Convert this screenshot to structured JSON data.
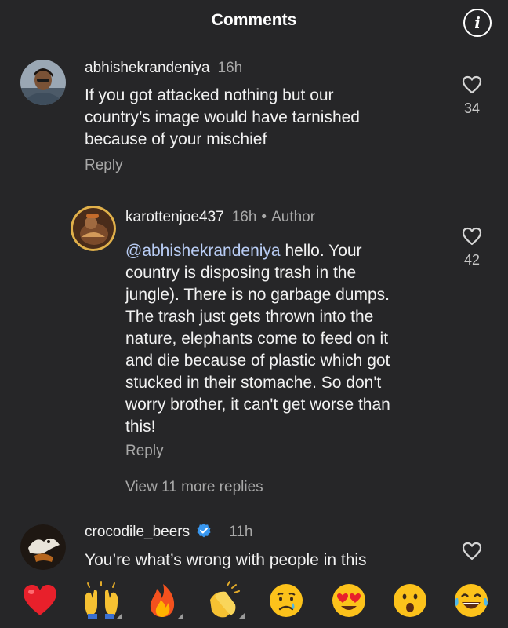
{
  "header": {
    "title": "Comments",
    "info_icon": "info-icon"
  },
  "comments": [
    {
      "username": "abhishekrandeniya",
      "time": "16h",
      "lines": [
        "If you got attacked nothing but our",
        "country’s image would have tarnished",
        "because of your mischief"
      ],
      "reply_label": "Reply",
      "likes": "34"
    },
    {
      "username": "karottenjoe437",
      "time": "16h",
      "badge": "Author",
      "mention": "@abhishekrandeniya",
      "first_line_rest": " hello. Your",
      "lines": [
        "country is disposing trash in the",
        "jungle). There is no garbage dumps.",
        "The trash just gets thrown into the",
        "nature, elephants come to feed on it",
        "and die because of plastic which got",
        "stucked in their stomache. So don't",
        "worry brother, it can't get worse than",
        "this!"
      ],
      "reply_label": "Reply",
      "likes": "42",
      "view_more": "View 11 more replies"
    },
    {
      "username": "crocodile_beers",
      "time": "11h",
      "verified": true,
      "lines": [
        "You’re what’s wrong with people in this"
      ]
    }
  ],
  "reactions": [
    "red-heart",
    "raising-hands",
    "fire",
    "clapping-hands",
    "crying-face",
    "heart-eyes-face",
    "surprised-face",
    "tears-of-joy-face"
  ],
  "colors": {
    "background": "#262628",
    "mention": "#b9cdf5",
    "secondary_text": "#a8a8a8",
    "verified": "#3897f0"
  }
}
